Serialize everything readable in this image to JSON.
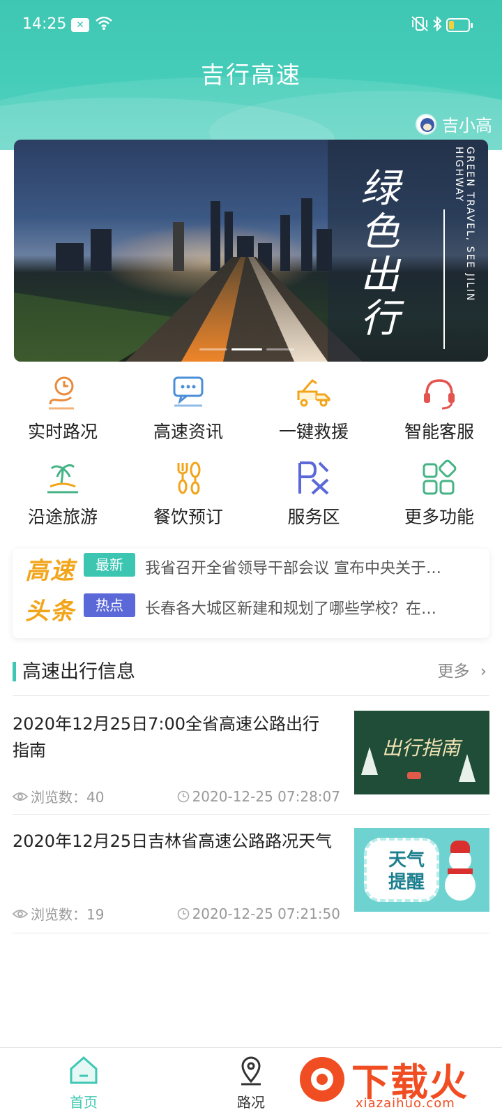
{
  "status_bar": {
    "time": "14:25"
  },
  "header": {
    "title": "吉行高速",
    "assistant_label": "吉小高"
  },
  "banner": {
    "slogan": "绿色出行",
    "slogan_en": "GREEN TRAVEL, SEE JILIN HIGHWAY",
    "slides": 3,
    "active_slide": 2
  },
  "features": [
    {
      "label": "实时路况",
      "icon": "clock-route-icon"
    },
    {
      "label": "高速资讯",
      "icon": "chat-news-icon"
    },
    {
      "label": "一键救援",
      "icon": "tow-truck-icon"
    },
    {
      "label": "智能客服",
      "icon": "headset-icon"
    },
    {
      "label": "沿途旅游",
      "icon": "palm-island-icon"
    },
    {
      "label": "餐饮预订",
      "icon": "fork-spoon-icon"
    },
    {
      "label": "服务区",
      "icon": "service-area-icon"
    },
    {
      "label": "更多功能",
      "icon": "grid-more-icon"
    }
  ],
  "headlines": {
    "logo_top": "高速",
    "logo_bottom": "头条",
    "items": [
      {
        "tag": "最新",
        "text": "我省召开全省领导干部会议 宣布中央关于…"
      },
      {
        "tag": "热点",
        "text": "长春各大城区新建和规划了哪些学校？在…"
      }
    ]
  },
  "travel_info": {
    "title": "高速出行信息",
    "more_label": "更多",
    "articles": [
      {
        "title": "2020年12月25日7:00全省高速公路出行指南",
        "views_label": "浏览数：40",
        "time": "2020-12-25 07:28:07",
        "thumb_text": "出行指南"
      },
      {
        "title": "2020年12月25日吉林省高速公路路况天气",
        "views_label": "浏览数：19",
        "time": "2020-12-25 07:21:50",
        "thumb_text": "天气提醒"
      }
    ]
  },
  "bottom_nav": {
    "items": [
      {
        "label": "首页",
        "active": true
      },
      {
        "label": "路况",
        "active": false
      }
    ]
  },
  "watermark": {
    "text": "下载火",
    "url": "xiazaihuo.com"
  },
  "colors": {
    "accent": "#3ec7b3",
    "hot_tag": "#5b68d8",
    "headline_logo": "#f2a51a"
  }
}
